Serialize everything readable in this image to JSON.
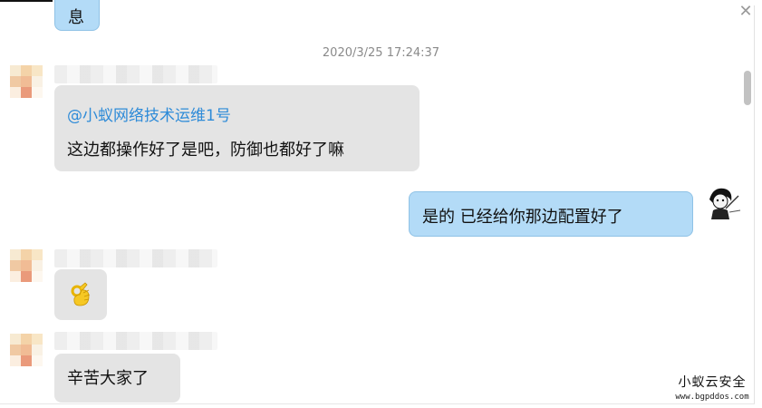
{
  "timestamp": "2020/3/25 17:24:37",
  "partial_top_message": "息",
  "messages": [
    {
      "sender_blurred": true,
      "mention": "@小蚁网络技术运维1号",
      "text": "这边都操作好了是吧，防御也都好了嘛"
    },
    {
      "self": true,
      "text": "是的    已经给你那边配置好了"
    },
    {
      "sender_blurred": true,
      "emoji": "ok-hand"
    },
    {
      "sender_blurred": true,
      "text": "辛苦大家了"
    }
  ],
  "watermark": {
    "title": "小蚁云安全",
    "url": "www.bgpddos.com"
  },
  "colors": {
    "bubble_gray": "#e4e4e4",
    "bubble_blue": "#b3dbf7",
    "mention": "#2e8bd8",
    "timestamp": "#8a8a8a"
  },
  "icons": [
    "close-icon",
    "ok-hand-icon",
    "avatar"
  ]
}
